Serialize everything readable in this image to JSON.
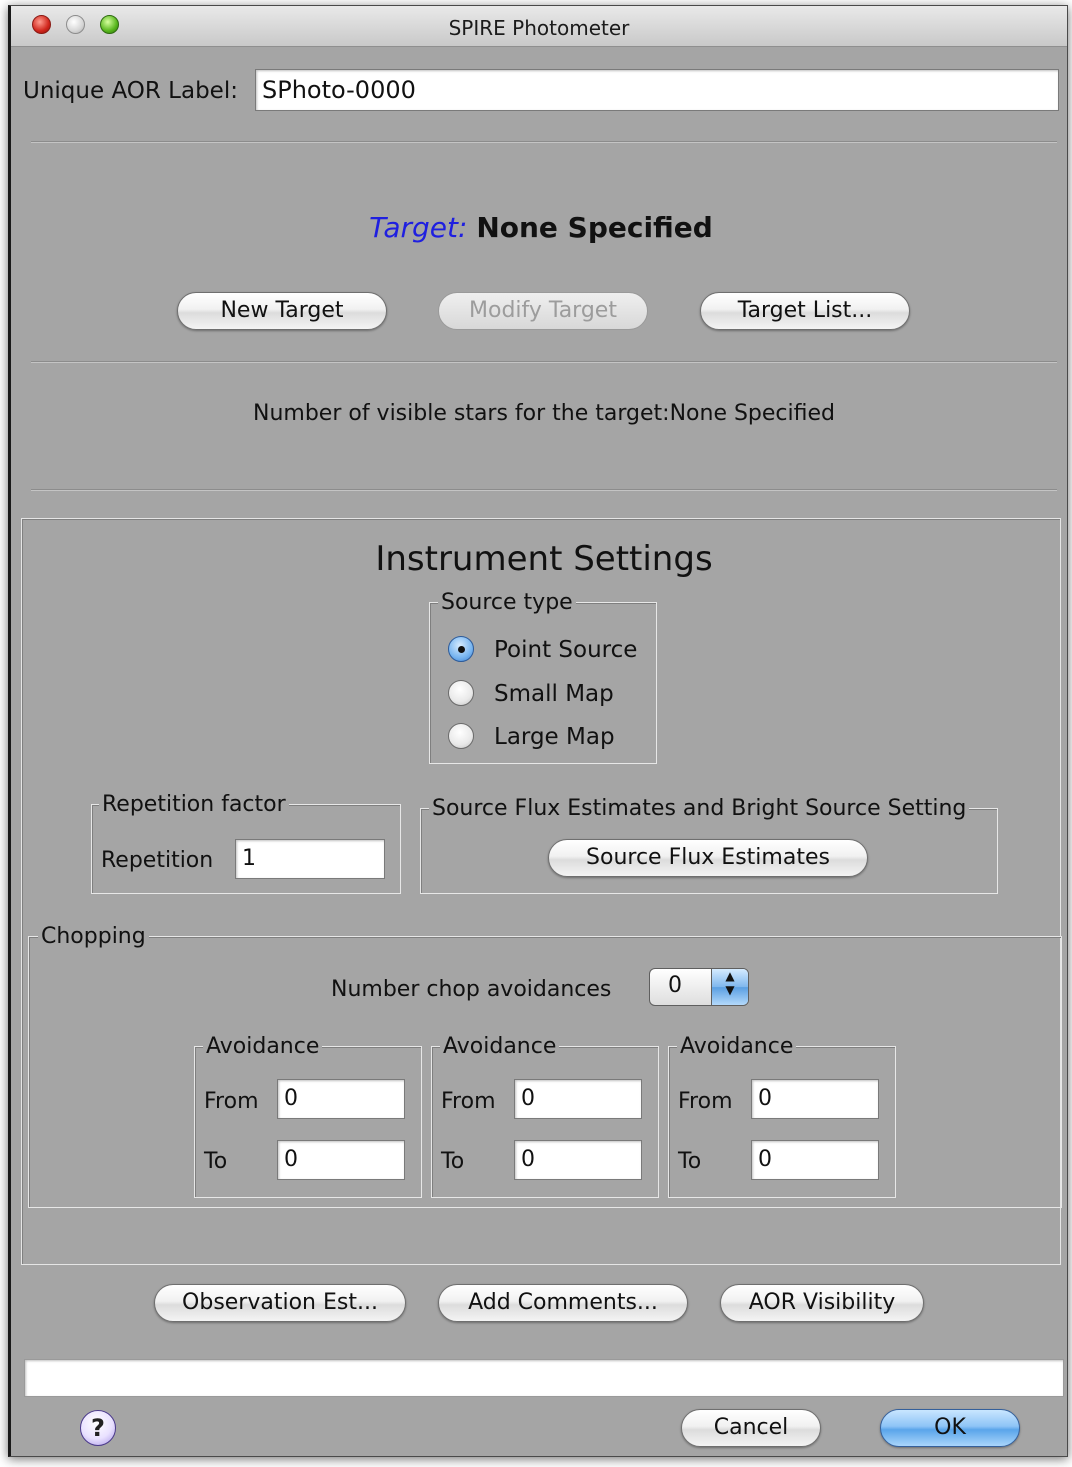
{
  "window": {
    "title": "SPIRE Photometer"
  },
  "header": {
    "aor_label": "Unique AOR Label:",
    "aor_value": "SPhoto-0000"
  },
  "target": {
    "label": "Target:",
    "value": "None Specified",
    "new_button": "New Target",
    "modify_button": "Modify Target",
    "list_button": "Target List...",
    "visible_stars": "Number of visible stars for the target:None Specified"
  },
  "instrument": {
    "heading": "Instrument Settings",
    "source_type": {
      "title": "Source type",
      "options": [
        "Point Source",
        "Small Map",
        "Large Map"
      ],
      "selected": "Point Source"
    },
    "repetition": {
      "title": "Repetition factor",
      "label": "Repetition",
      "value": "1"
    },
    "flux": {
      "title": "Source Flux Estimates and Bright Source Setting",
      "button": "Source Flux Estimates"
    },
    "chopping": {
      "title": "Chopping",
      "avoidances_label": "Number chop avoidances",
      "avoidances_value": "0",
      "avoidances": [
        {
          "title": "Avoidance",
          "from_label": "From",
          "from": "0",
          "to_label": "To",
          "to": "0"
        },
        {
          "title": "Avoidance",
          "from_label": "From",
          "from": "0",
          "to_label": "To",
          "to": "0"
        },
        {
          "title": "Avoidance",
          "from_label": "From",
          "from": "0",
          "to_label": "To",
          "to": "0"
        }
      ]
    }
  },
  "bottom": {
    "obs_button": "Observation Est...",
    "comments_button": "Add Comments...",
    "visibility_button": "AOR Visibility",
    "status_text": "",
    "help": "?",
    "cancel_button": "Cancel",
    "ok_button": "OK"
  },
  "colors": {
    "window_bg": "#a5a5a5",
    "target_label": "#1f1fe0",
    "default_button": "#5aa5ea"
  }
}
